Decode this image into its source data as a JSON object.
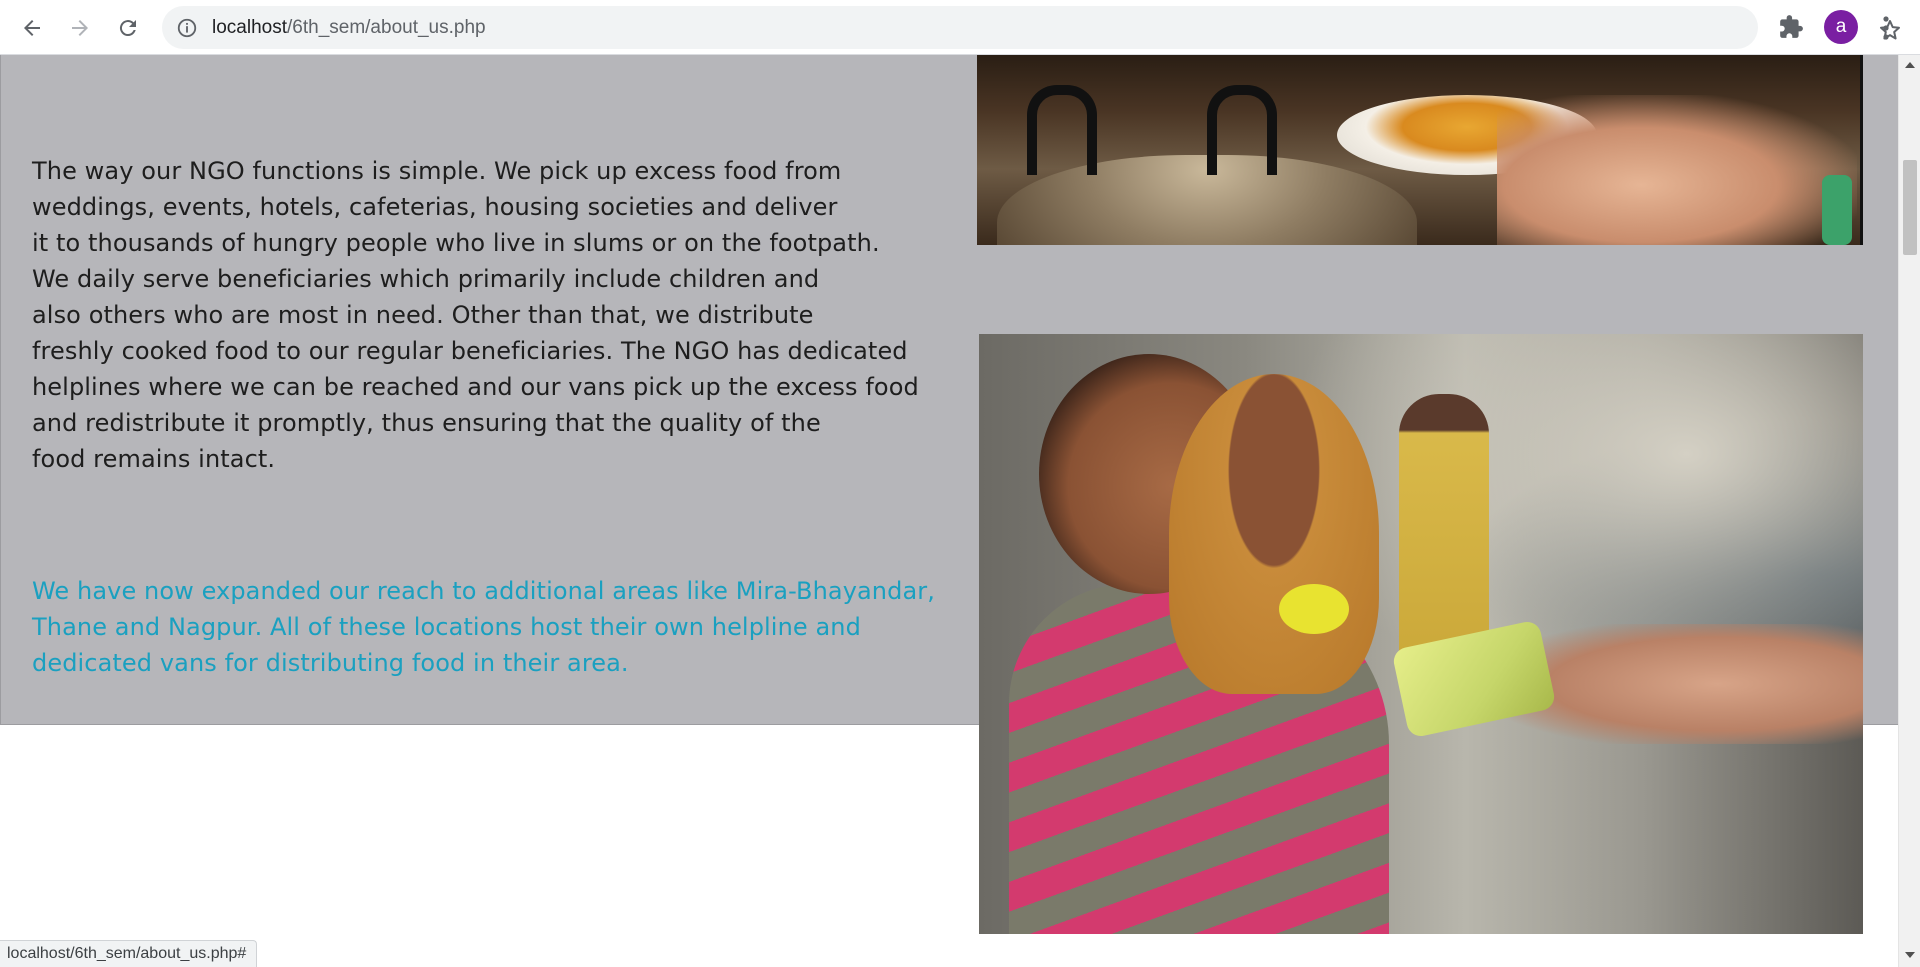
{
  "browser": {
    "url_host": "localhost",
    "url_path": "/6th_sem/about_us.php",
    "profile_initial": "a",
    "status_url": "localhost/6th_sem/about_us.php#",
    "icons": {
      "back": "arrow-left-icon",
      "forward": "arrow-right-icon",
      "reload": "reload-icon",
      "site_info": "info-icon",
      "bookmark": "star-icon",
      "extensions": "puzzle-icon",
      "menu": "kebab-menu-icon"
    },
    "colors": {
      "avatar": "#7a1fa2"
    }
  },
  "about": {
    "paragraph_lines": [
      "The way our NGO functions is simple. We pick up excess food from",
      "weddings, events, hotels, cafeterias, housing societies and deliver",
      "it to thousands of hungry people who live in slums or on the footpath.",
      "We daily serve beneficiaries which primarily include children and",
      "also others who are most in need. Other than that, we distribute",
      "freshly cooked food to our regular beneficiaries. The NGO has dedicated",
      "helplines where we can be reached and our vans pick up the excess food",
      "and redistribute it promptly, thus ensuring that the quality of the",
      "food remains intact."
    ],
    "expansion_lines": [
      "We have now expanded our reach to additional areas like Mira-Bhayandar,",
      "Thane and Nagpur. All of these locations host their own helpline and",
      "dedicated vans for distributing food in their area."
    ],
    "colors": {
      "band": "#b6b6ba",
      "text": "#1e1e1e",
      "highlight": "#1aa0c0"
    }
  }
}
